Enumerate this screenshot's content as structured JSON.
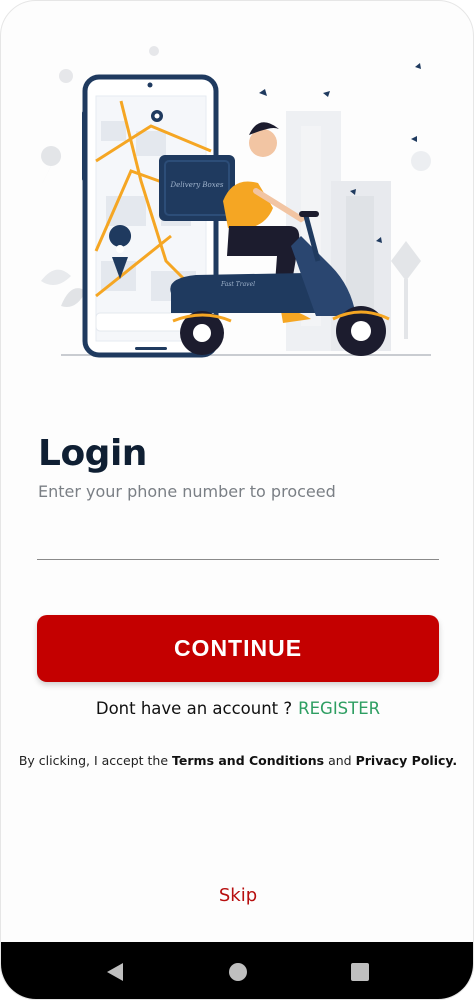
{
  "illustration": {
    "bag_text": "Delivery Boxes",
    "scooter_text": "Fast Travel"
  },
  "login": {
    "title": "Login",
    "subtitle": "Enter your phone number to proceed",
    "phone_value": "",
    "continue_label": "CONTINUE"
  },
  "register": {
    "prompt": "Dont have an account ?",
    "link": "REGISTER"
  },
  "terms": {
    "prefix": "By clicking, I accept the",
    "terms_link": "Terms and Conditions",
    "and": "and",
    "privacy_link": "Privacy Policy."
  },
  "skip": "Skip",
  "navbar": {
    "back": "back-triangle",
    "home": "home-circle",
    "recent": "recents-square"
  },
  "colors": {
    "primary": "#c40000",
    "link_green": "#2e9e62",
    "title": "#0f1f33",
    "illustration_navy": "#1f3a5f",
    "illustration_orange": "#f5a623"
  }
}
